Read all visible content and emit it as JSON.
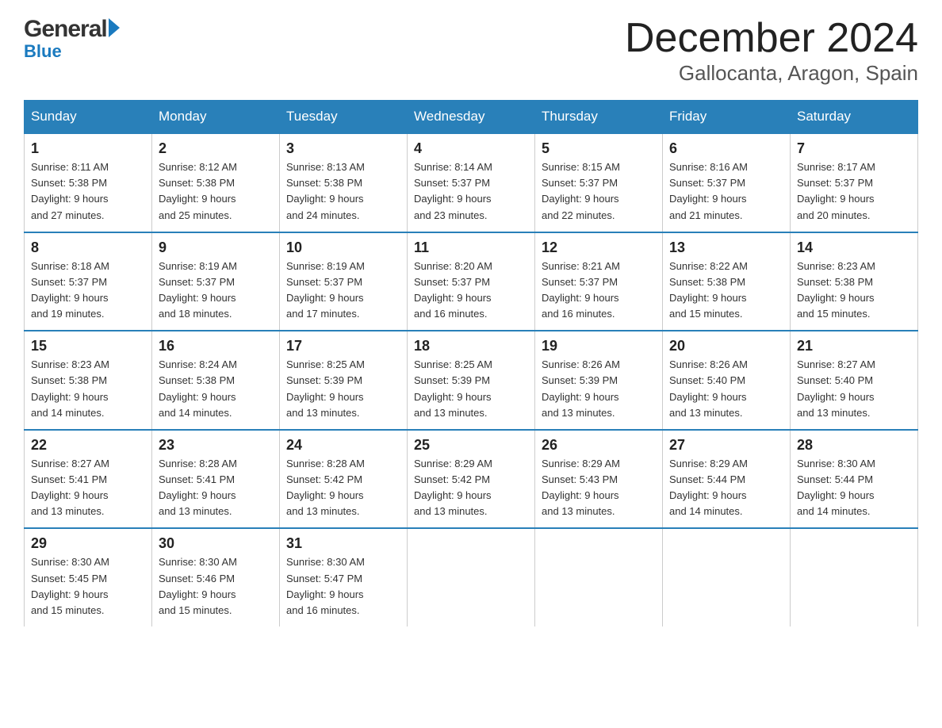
{
  "header": {
    "month_title": "December 2024",
    "location": "Gallocanta, Aragon, Spain",
    "logo_general": "General",
    "logo_blue": "Blue"
  },
  "columns": [
    "Sunday",
    "Monday",
    "Tuesday",
    "Wednesday",
    "Thursday",
    "Friday",
    "Saturday"
  ],
  "weeks": [
    [
      {
        "day": "1",
        "sunrise": "8:11 AM",
        "sunset": "5:38 PM",
        "daylight": "9 hours and 27 minutes."
      },
      {
        "day": "2",
        "sunrise": "8:12 AM",
        "sunset": "5:38 PM",
        "daylight": "9 hours and 25 minutes."
      },
      {
        "day": "3",
        "sunrise": "8:13 AM",
        "sunset": "5:38 PM",
        "daylight": "9 hours and 24 minutes."
      },
      {
        "day": "4",
        "sunrise": "8:14 AM",
        "sunset": "5:37 PM",
        "daylight": "9 hours and 23 minutes."
      },
      {
        "day": "5",
        "sunrise": "8:15 AM",
        "sunset": "5:37 PM",
        "daylight": "9 hours and 22 minutes."
      },
      {
        "day": "6",
        "sunrise": "8:16 AM",
        "sunset": "5:37 PM",
        "daylight": "9 hours and 21 minutes."
      },
      {
        "day": "7",
        "sunrise": "8:17 AM",
        "sunset": "5:37 PM",
        "daylight": "9 hours and 20 minutes."
      }
    ],
    [
      {
        "day": "8",
        "sunrise": "8:18 AM",
        "sunset": "5:37 PM",
        "daylight": "9 hours and 19 minutes."
      },
      {
        "day": "9",
        "sunrise": "8:19 AM",
        "sunset": "5:37 PM",
        "daylight": "9 hours and 18 minutes."
      },
      {
        "day": "10",
        "sunrise": "8:19 AM",
        "sunset": "5:37 PM",
        "daylight": "9 hours and 17 minutes."
      },
      {
        "day": "11",
        "sunrise": "8:20 AM",
        "sunset": "5:37 PM",
        "daylight": "9 hours and 16 minutes."
      },
      {
        "day": "12",
        "sunrise": "8:21 AM",
        "sunset": "5:37 PM",
        "daylight": "9 hours and 16 minutes."
      },
      {
        "day": "13",
        "sunrise": "8:22 AM",
        "sunset": "5:38 PM",
        "daylight": "9 hours and 15 minutes."
      },
      {
        "day": "14",
        "sunrise": "8:23 AM",
        "sunset": "5:38 PM",
        "daylight": "9 hours and 15 minutes."
      }
    ],
    [
      {
        "day": "15",
        "sunrise": "8:23 AM",
        "sunset": "5:38 PM",
        "daylight": "9 hours and 14 minutes."
      },
      {
        "day": "16",
        "sunrise": "8:24 AM",
        "sunset": "5:38 PM",
        "daylight": "9 hours and 14 minutes."
      },
      {
        "day": "17",
        "sunrise": "8:25 AM",
        "sunset": "5:39 PM",
        "daylight": "9 hours and 13 minutes."
      },
      {
        "day": "18",
        "sunrise": "8:25 AM",
        "sunset": "5:39 PM",
        "daylight": "9 hours and 13 minutes."
      },
      {
        "day": "19",
        "sunrise": "8:26 AM",
        "sunset": "5:39 PM",
        "daylight": "9 hours and 13 minutes."
      },
      {
        "day": "20",
        "sunrise": "8:26 AM",
        "sunset": "5:40 PM",
        "daylight": "9 hours and 13 minutes."
      },
      {
        "day": "21",
        "sunrise": "8:27 AM",
        "sunset": "5:40 PM",
        "daylight": "9 hours and 13 minutes."
      }
    ],
    [
      {
        "day": "22",
        "sunrise": "8:27 AM",
        "sunset": "5:41 PM",
        "daylight": "9 hours and 13 minutes."
      },
      {
        "day": "23",
        "sunrise": "8:28 AM",
        "sunset": "5:41 PM",
        "daylight": "9 hours and 13 minutes."
      },
      {
        "day": "24",
        "sunrise": "8:28 AM",
        "sunset": "5:42 PM",
        "daylight": "9 hours and 13 minutes."
      },
      {
        "day": "25",
        "sunrise": "8:29 AM",
        "sunset": "5:42 PM",
        "daylight": "9 hours and 13 minutes."
      },
      {
        "day": "26",
        "sunrise": "8:29 AM",
        "sunset": "5:43 PM",
        "daylight": "9 hours and 13 minutes."
      },
      {
        "day": "27",
        "sunrise": "8:29 AM",
        "sunset": "5:44 PM",
        "daylight": "9 hours and 14 minutes."
      },
      {
        "day": "28",
        "sunrise": "8:30 AM",
        "sunset": "5:44 PM",
        "daylight": "9 hours and 14 minutes."
      }
    ],
    [
      {
        "day": "29",
        "sunrise": "8:30 AM",
        "sunset": "5:45 PM",
        "daylight": "9 hours and 15 minutes."
      },
      {
        "day": "30",
        "sunrise": "8:30 AM",
        "sunset": "5:46 PM",
        "daylight": "9 hours and 15 minutes."
      },
      {
        "day": "31",
        "sunrise": "8:30 AM",
        "sunset": "5:47 PM",
        "daylight": "9 hours and 16 minutes."
      },
      null,
      null,
      null,
      null
    ]
  ]
}
